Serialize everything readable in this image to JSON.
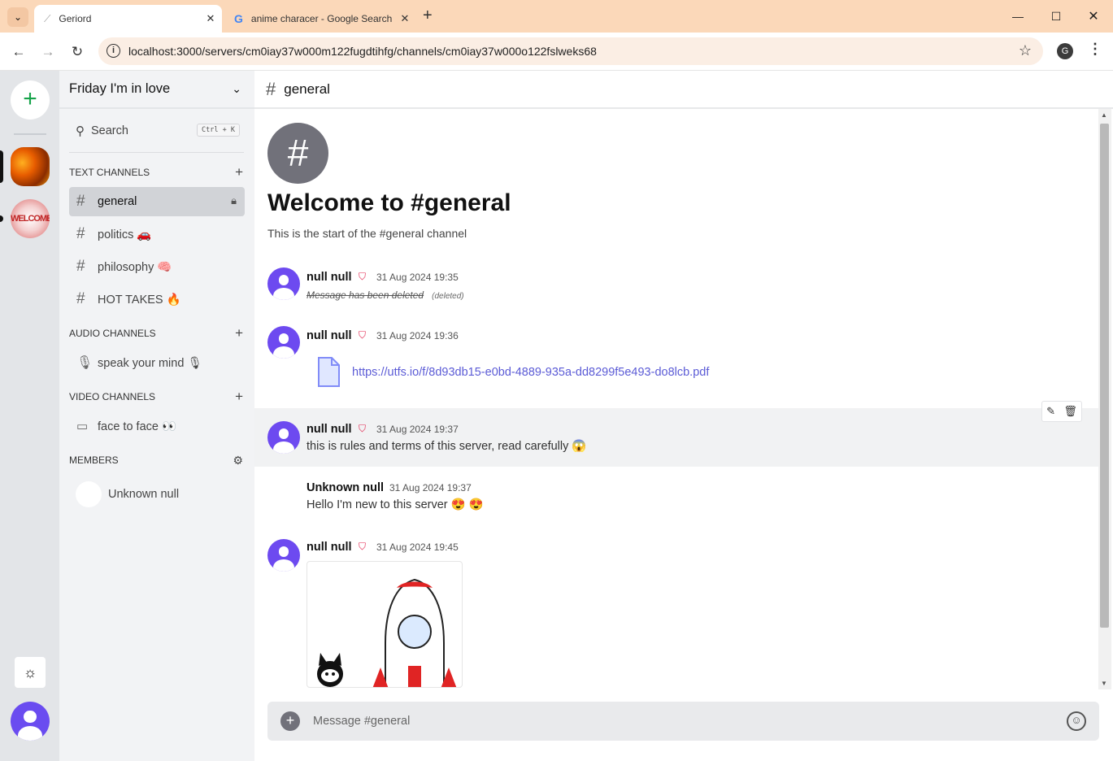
{
  "browser": {
    "tabs": [
      {
        "title": "Geriord",
        "active": true
      },
      {
        "title": "anime characer - Google Search",
        "active": false
      }
    ],
    "new_tab": "+",
    "url": "localhost:3000/servers/cm0iay37w000m122fugdtihfg/channels/cm0iay37w000o122fslweks68",
    "profile_initial": "G"
  },
  "rail": {
    "servers": [
      {
        "name": "server-1"
      },
      {
        "name": "server-welcome",
        "label": "WELCOME"
      }
    ]
  },
  "sidebar": {
    "server_name": "Friday I'm in love",
    "search": {
      "label": "Search",
      "shortcut": "Ctrl + K"
    },
    "sections": {
      "text": "TEXT CHANNELS",
      "audio": "AUDIO CHANNELS",
      "video": "VIDEO CHANNELS",
      "members": "MEMBERS"
    },
    "text_channels": [
      "general",
      "politics 🚗",
      "philosophy 🧠",
      "HOT TAKES 🔥"
    ],
    "audio_channels": [
      "speak your mind 🎙"
    ],
    "video_channels": [
      "face to face 👀"
    ],
    "members": [
      "Unknown null"
    ]
  },
  "main": {
    "channel": "general",
    "welcome_title": "Welcome to #general",
    "welcome_sub": "This is the start of the #general channel",
    "messages": [
      {
        "author": "null null",
        "time": "31 Aug 2024 19:35",
        "text": "Message has been deleted",
        "tag": "(deleted)"
      },
      {
        "author": "null null",
        "time": "31 Aug 2024 19:36",
        "link": "https://utfs.io/f/8d93db15-e0bd-4889-935a-dd8299f5e493-do8lcb.pdf"
      },
      {
        "author": "null null",
        "time": "31 Aug 2024 19:37",
        "text": "this is rules and terms of this server, read carefully 😱"
      },
      {
        "author": "Unknown null",
        "time": "31 Aug 2024 19:37",
        "text": "Hello I'm new to this server 😍 😍"
      },
      {
        "author": "null null",
        "time": "31 Aug 2024 19:45"
      }
    ],
    "composer_placeholder": "Message #general"
  }
}
